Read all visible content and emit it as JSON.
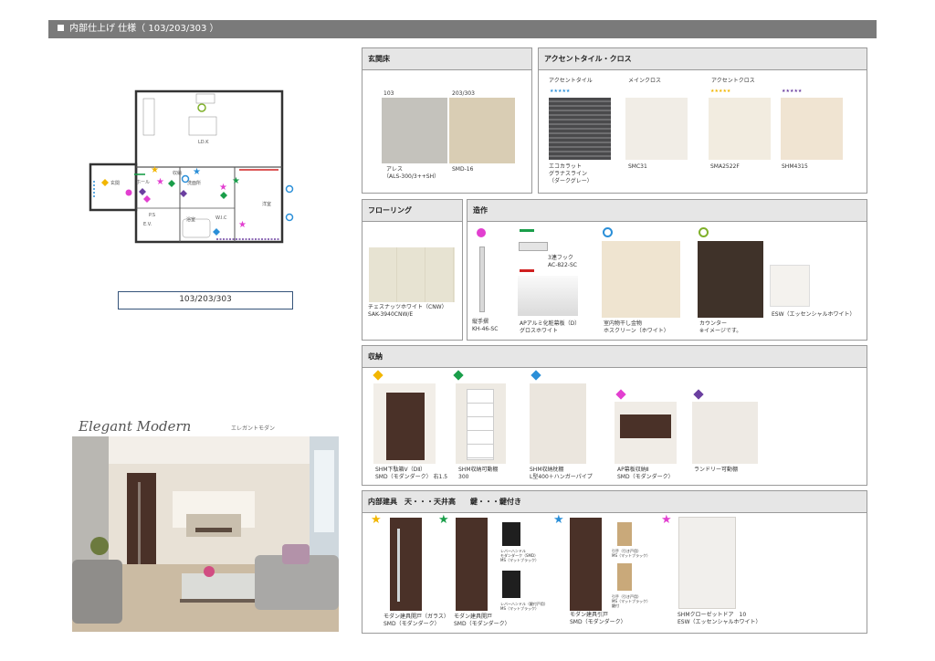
{
  "header": {
    "title": "内部仕上げ 仕様（ 103/203/303 ）"
  },
  "plan": {
    "unit_label": "103/203/303",
    "room_labels": [
      "LD.K",
      "玄関",
      "ホール",
      "洗面所",
      "浴室",
      "洋室",
      "W.I.C",
      "P.S",
      "収納",
      "E.V."
    ]
  },
  "style": {
    "title": "Elegant Modern",
    "subtitle": "エレガントモダン"
  },
  "entrance": {
    "heading": "玄関床",
    "items": [
      {
        "label": "103",
        "name": "アレス",
        "code": "（ALS-300/3++SH）",
        "color": "#c4c2bc"
      },
      {
        "label": "203/303",
        "name": "SMD-16",
        "code": "",
        "color": "#d9cdb4"
      }
    ]
  },
  "accent": {
    "heading": "アクセントタイル・クロス",
    "col1": "アクセントタイル",
    "col2": "メインクロス",
    "col3": "アクセントクロス",
    "items": [
      {
        "name": "エコカラット\nグラナスライン\n（ダークグレー）",
        "color": "#5b5b5d"
      },
      {
        "name": "SMC31",
        "color": "#f1ede6"
      },
      {
        "name": "SMA2522F",
        "color": "#f2ece0"
      },
      {
        "name": "SHM4315",
        "color": "#f0e4d2"
      }
    ]
  },
  "flooring": {
    "heading": "フローリング",
    "name": "チェスナッツホワイト（CNW）",
    "code": "SAK-3940CNW/E",
    "color": "#e7e3d2"
  },
  "fixtures": {
    "heading": "造作",
    "items": [
      {
        "name": "縦手摺\nKH-46-SC"
      },
      {
        "name": "3連フック\nAC-822-SC"
      },
      {
        "name": "APアルミ化粧幕板（D）\nグロスホワイト"
      },
      {
        "name": "室内物干し金物\nホスクリーン（ホワイト）"
      },
      {
        "name": "カウンター\n※イメージです。"
      },
      {
        "name": "ESW（エッセンシャルホワイト）"
      }
    ]
  },
  "storage": {
    "heading": "収納",
    "items": [
      {
        "name": "SHM下駄箱V（DⅡ）\nSMD（モダンダーク） 右1.5"
      },
      {
        "name": "SHM収納可動棚\n300"
      },
      {
        "name": "SHM収納枕棚\nL型400＋ハンガーパイプ"
      },
      {
        "name": "AP幕板収納Ⅱ\nSMD（モダンダーク）"
      },
      {
        "name": "ランドリー可動棚"
      }
    ]
  },
  "doors": {
    "heading": "内部建具　天・・・天井高　　鍵・・・鍵付き",
    "items": [
      {
        "name": "モダン建具開戸（ガラス）\nSMD（モダンダーク）"
      },
      {
        "name": "モダン建具開戸\nSMD（モダンダーク）"
      },
      {
        "name": "モダン建具引戸\nSMD（モダンダーク）"
      },
      {
        "name": "SHMクローゼットドア　10\nESW（エッセンシャルホワイト）"
      }
    ],
    "handle_notes": [
      "レバーハンドル\nモダンダーク（SMD）\nMS（マットブラック）",
      "レバーハンドル（鍵付戸用）\nMS（マットブラック）",
      "引手（引き戸用）\nMS（マットブラック）",
      "引手（引き戸用）\nMS（マットブラック）\n鍵付"
    ]
  },
  "colors": {
    "header_bar": "#7a7a7a",
    "panel_header": "#e6e6e6",
    "unit_border": "#35537a",
    "dark_wood": "#4a3128",
    "marker_yellow": "#f2b600",
    "marker_green": "#1a9e4a",
    "marker_blue": "#2b8fd8",
    "marker_magenta": "#e23fd0",
    "marker_purple": "#6b3fa0"
  }
}
